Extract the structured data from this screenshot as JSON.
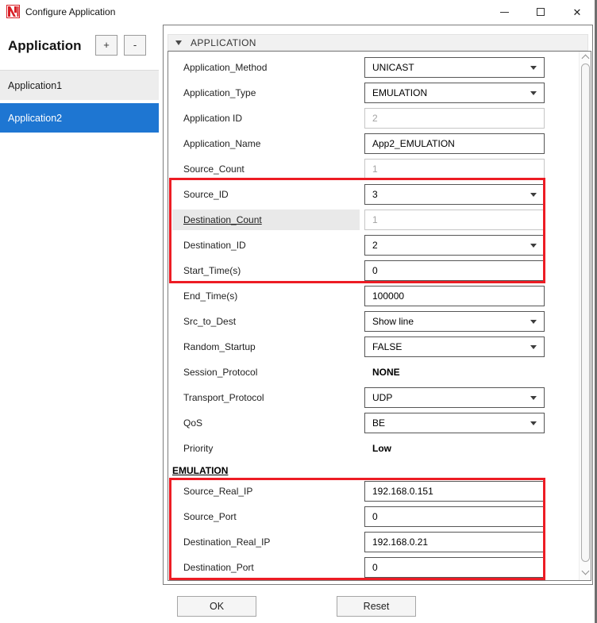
{
  "window": {
    "title": "Configure Application"
  },
  "titlebar_icons": {
    "minimize": "minimize-dash",
    "maximize": "maximize-square",
    "close": "✕"
  },
  "left_panel": {
    "title": "Application",
    "add_button": "+",
    "remove_button": "-",
    "items": [
      {
        "label": "Application1",
        "selected": false
      },
      {
        "label": "Application2",
        "selected": true
      }
    ]
  },
  "property_grid": {
    "section_header": "APPLICATION",
    "rows": [
      {
        "label": "Application_Method",
        "control": "dropdown",
        "value": "UNICAST"
      },
      {
        "label": "Application_Type",
        "control": "dropdown",
        "value": "EMULATION"
      },
      {
        "label": "Application ID",
        "control": "textbox_disabled",
        "value": "2"
      },
      {
        "label": "Application_Name",
        "control": "textbox",
        "value": "App2_EMULATION"
      },
      {
        "label": "Source_Count",
        "control": "textbox_disabled",
        "value": "1"
      },
      {
        "label": "Source_ID",
        "control": "dropdown",
        "value": "3"
      },
      {
        "label": "Destination_Count",
        "control": "textbox_disabled",
        "value": "1",
        "label_highlight": true
      },
      {
        "label": "Destination_ID",
        "control": "dropdown",
        "value": "2"
      },
      {
        "label": "Start_Time(s)",
        "control": "textbox",
        "value": "0"
      },
      {
        "label": "End_Time(s)",
        "control": "textbox",
        "value": "100000"
      },
      {
        "label": "Src_to_Dest",
        "control": "dropdown",
        "value": "Show line"
      },
      {
        "label": "Random_Startup",
        "control": "dropdown",
        "value": "FALSE"
      },
      {
        "label": "Session_Protocol",
        "control": "static",
        "value": "NONE"
      },
      {
        "label": "Transport_Protocol",
        "control": "dropdown",
        "value": "UDP"
      },
      {
        "label": "QoS",
        "control": "dropdown",
        "value": "BE"
      },
      {
        "label": "Priority",
        "control": "static",
        "value": "Low"
      }
    ],
    "emulation_header": "EMULATION",
    "emulation_rows": [
      {
        "label": "Source_Real_IP",
        "control": "textbox",
        "value": "192.168.0.151"
      },
      {
        "label": "Source_Port",
        "control": "textbox",
        "value": "0"
      },
      {
        "label": "Destination_Real_IP",
        "control": "textbox",
        "value": "192.168.0.21"
      },
      {
        "label": "Destination_Port",
        "control": "textbox",
        "value": "0"
      }
    ]
  },
  "footer": {
    "ok_label": "OK",
    "reset_label": "Reset"
  },
  "colors": {
    "selection_blue": "#1e76d2",
    "annotation_red": "#ed1c24",
    "logo_red": "#d81f26"
  }
}
